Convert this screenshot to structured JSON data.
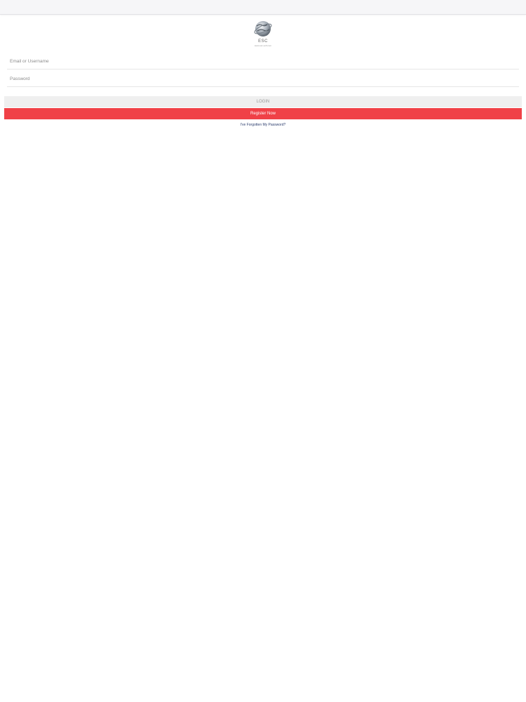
{
  "header": {
    "logo_icon": "globe-ring-logo-icon",
    "logo_text": "ESC",
    "logo_subtext": "www.esc-soft.com"
  },
  "form": {
    "email_placeholder": "Email or Username",
    "email_value": "",
    "password_placeholder": "Password",
    "password_value": "",
    "login_label": "LOGIN",
    "register_label": "Register Now",
    "forgot_label": "I've Forgotten My Password?"
  },
  "colors": {
    "register_button": "#f04147",
    "login_button": "#efefef",
    "link": "#2c3e6e"
  }
}
